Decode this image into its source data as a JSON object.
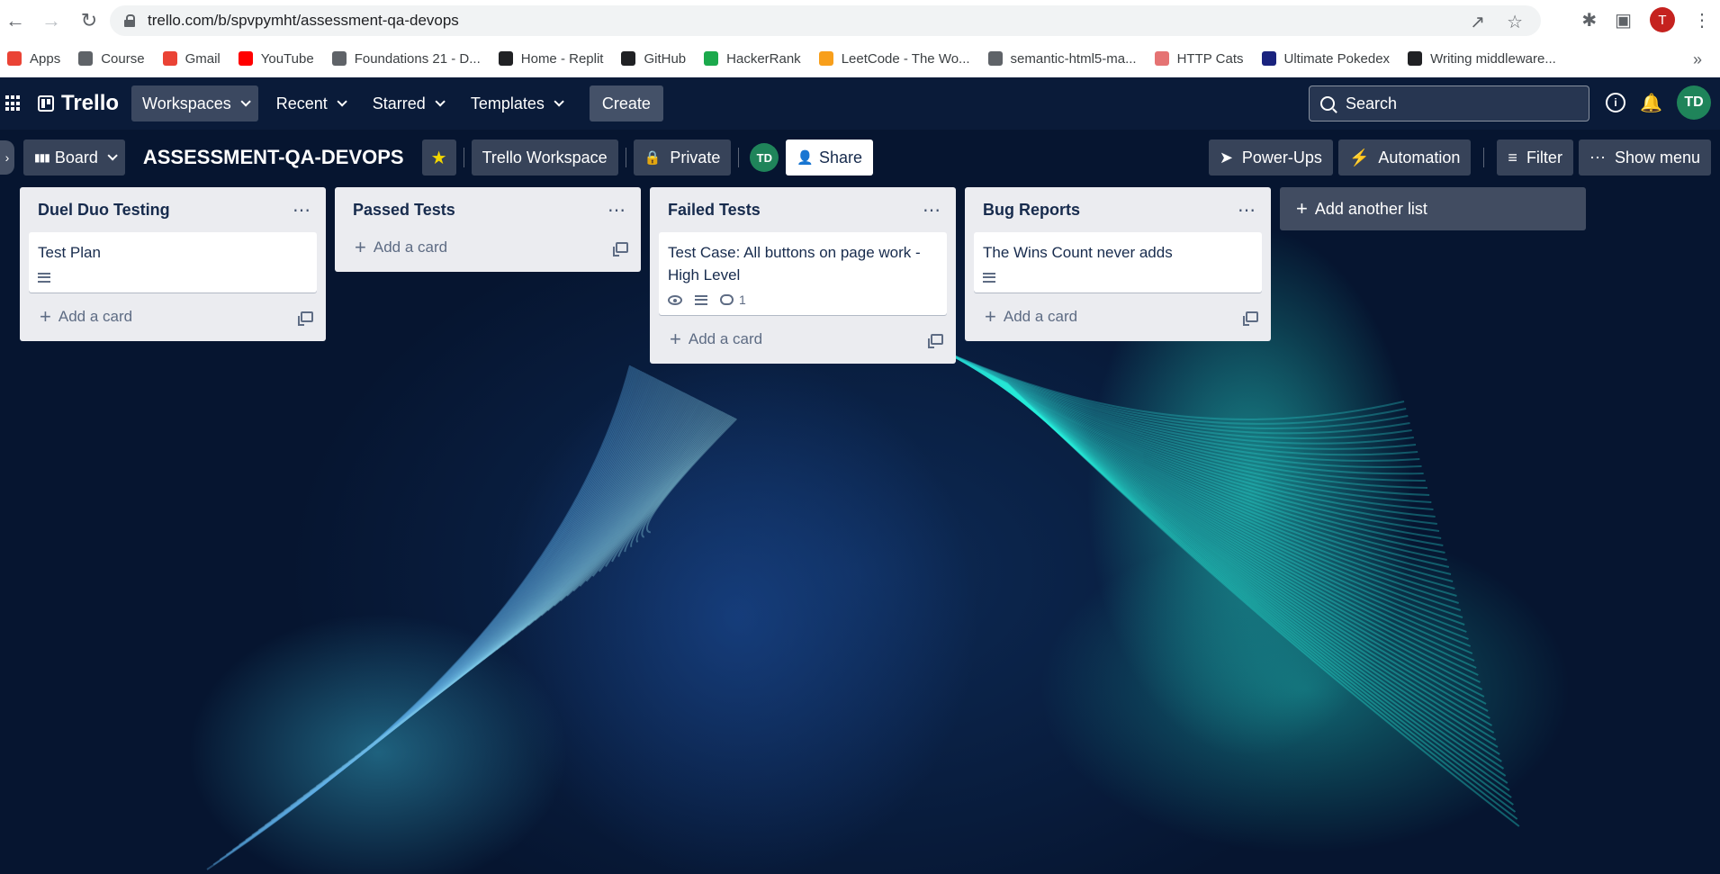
{
  "browser": {
    "url": "trello.com/b/spvpymht/assessment-qa-devops",
    "profile_initial": "T",
    "bookmarks": [
      {
        "label": "Apps",
        "icon": "apps-grid-icon",
        "color": "#ea4335"
      },
      {
        "label": "Course",
        "icon": "globe-icon",
        "color": "#5f6368"
      },
      {
        "label": "Gmail",
        "icon": "gmail-icon",
        "color": "#ea4335"
      },
      {
        "label": "YouTube",
        "icon": "youtube-icon",
        "color": "#ff0000"
      },
      {
        "label": "Foundations 21 - D...",
        "icon": "globe-icon",
        "color": "#5f6368"
      },
      {
        "label": "Home - Replit",
        "icon": "replit-icon",
        "color": "#202124"
      },
      {
        "label": "GitHub",
        "icon": "github-icon",
        "color": "#202124"
      },
      {
        "label": "HackerRank",
        "icon": "hackerrank-icon",
        "color": "#1ba94c"
      },
      {
        "label": "LeetCode - The Wo...",
        "icon": "leetcode-icon",
        "color": "#f89f1b"
      },
      {
        "label": "semantic-html5-ma...",
        "icon": "globe-icon",
        "color": "#5f6368"
      },
      {
        "label": "HTTP Cats",
        "icon": "cat-icon",
        "color": "#e57373"
      },
      {
        "label": "Ultimate Pokedex",
        "icon": "pokeball-icon",
        "color": "#1a237e"
      },
      {
        "label": "Writing middleware...",
        "icon": "express-icon",
        "color": "#202124"
      }
    ]
  },
  "topnav": {
    "logo": "Trello",
    "menus": [
      "Workspaces",
      "Recent",
      "Starred",
      "Templates"
    ],
    "create": "Create",
    "search_placeholder": "Search",
    "avatar": "TD"
  },
  "board": {
    "view": "Board",
    "title": "ASSESSMENT-QA-DEVOPS",
    "workspace": "Trello Workspace",
    "visibility": "Private",
    "member": "TD",
    "share": "Share",
    "power_ups": "Power-Ups",
    "automation": "Automation",
    "filter": "Filter",
    "show_menu": "Show menu"
  },
  "lists": [
    {
      "title": "Duel Duo Testing",
      "cards": [
        {
          "title": "Test Plan",
          "has_desc": true,
          "watching": false,
          "comments": ""
        }
      ]
    },
    {
      "title": "Passed Tests",
      "cards": []
    },
    {
      "title": "Failed Tests",
      "cards": [
        {
          "title": "Test Case: All buttons on page work - High Level",
          "has_desc": true,
          "watching": true,
          "comments": "1"
        }
      ]
    },
    {
      "title": "Bug Reports",
      "cards": [
        {
          "title": "The Wins Count never adds",
          "has_desc": true,
          "watching": false,
          "comments": ""
        }
      ]
    }
  ],
  "add_card_label": "Add a card",
  "add_list_label": "Add another list"
}
